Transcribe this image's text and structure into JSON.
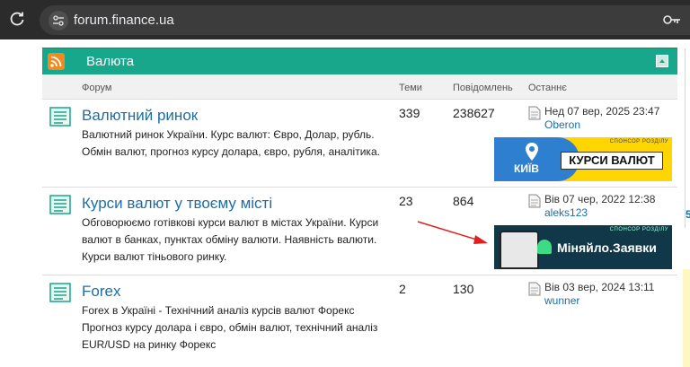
{
  "browser": {
    "url": "forum.finance.ua",
    "reload_icon": "reload-icon",
    "site_info_icon": "site-info-icon",
    "key_icon": "key-icon"
  },
  "category": {
    "title": "Валюта",
    "rss_icon": "rss-icon",
    "collapse_icon": "collapse-icon",
    "header_color": "#18a78b"
  },
  "columns": {
    "forum": "Форум",
    "topics": "Теми",
    "posts": "Повідомлень",
    "last": "Останнє"
  },
  "forums": [
    {
      "title": "Валютний ринок",
      "description": "Валютний ринок України. Курс валют: Євро, Долар, рубль. Обмін валют, прогноз курсу долара, євро, рубля, аналітика.",
      "topics": "339",
      "posts": "238627",
      "last_date": "Нед 07 вер, 2025 23:47",
      "last_user": "Oberon",
      "banner": {
        "sponsor": "СПОНСОР РОЗДІЛУ",
        "city": "КИЇВ",
        "title": "КУРСИ ВАЛЮТ"
      }
    },
    {
      "title": "Курси валют у твоєму місті",
      "description": "Обговорюємо готівкові курси валют в містах України. Курси валют в банках, пунктах обміну валюти. Наявність валюти. Курси валют тіньового ринку.",
      "topics": "23",
      "posts": "864",
      "last_date": "Вів 07 чер, 2022 12:38",
      "last_user": "aleks123",
      "banner": {
        "sponsor": "СПОНСОР РОЗДІЛУ",
        "title": "Міняйло.Заявки"
      }
    },
    {
      "title": "Forex",
      "description": "Forex в Україні - Технічний аналіз курсів валют Форекс Прогноз курсу долара і євро, обмін валют, технічний аналіз EUR/USD на ринку Форекс",
      "topics": "2",
      "posts": "130",
      "last_date": "Вів 03 вер, 2024 13:11",
      "last_user": "wunner"
    }
  ],
  "right_edge_char": "5"
}
